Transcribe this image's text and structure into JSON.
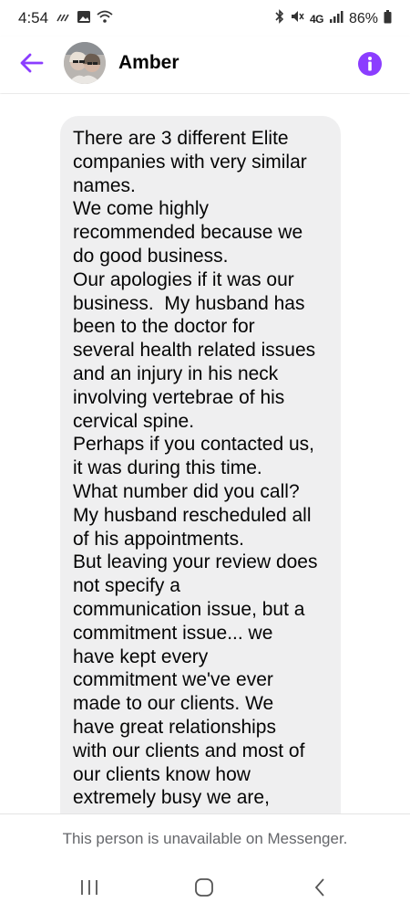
{
  "status_bar": {
    "time": "4:54",
    "network": "4G",
    "battery": "86%"
  },
  "header": {
    "contact_name": "Amber",
    "accent_color": "#8b3dff"
  },
  "message": {
    "lines": [
      "There are 3 different Elite",
      "companies with very similar",
      "names.",
      "We come highly",
      "recommended because we",
      "do good business.",
      "Our apologies if it was our",
      "business.  My husband has",
      "been to the doctor for",
      "several health related issues",
      "and an injury in his neck",
      "involving vertebrae of his",
      "cervical spine.",
      "Perhaps if you contacted us,",
      "it was during this time.",
      "What number did you call?",
      "My husband rescheduled all",
      "of his appointments.",
      "But leaving your review does",
      "not specify a",
      "communication issue, but a",
      "commitment issue... we",
      "have kept every",
      "commitment we've ever",
      "made to our clients. We",
      "have great relationships",
      "with our clients and most of",
      "our clients know how",
      "extremely busy we are,"
    ]
  },
  "footer": {
    "unavailable_text": "This person is unavailable on Messenger."
  }
}
